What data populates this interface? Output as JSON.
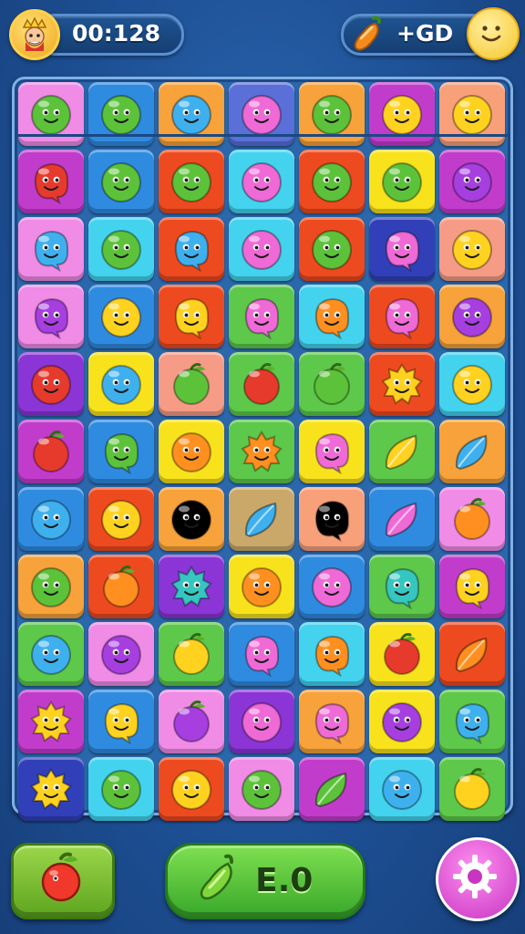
{
  "hud": {
    "timer": "00:128",
    "bonus": "+GD"
  },
  "footer": {
    "score_label": "E.0"
  },
  "colors": {
    "pink": "#f08be6",
    "blue": "#2f8be0",
    "orange": "#f7a23a",
    "indigo": "#5a6fd8",
    "magenta": "#c23ccc",
    "peach": "#f7a07a",
    "red": "#ee4a1f",
    "cyan": "#43d3ee",
    "yellow": "#f8e21c",
    "purple": "#8b35d6",
    "green": "#5dc84a",
    "salmon": "#f59b86",
    "tan": "#c9a86a",
    "navy": "#3140b8",
    "face_green": "#5cc23a",
    "face_blue": "#3fb0ee",
    "face_pink": "#ef6ad6",
    "face_yellow": "#ffd21f",
    "face_red": "#e63a2c",
    "face_orange": "#ff8f1f",
    "face_purple": "#a63ee0",
    "face_teal": "#36c6c0"
  },
  "board": {
    "rows": [
      [
        [
          "pink",
          "face_green",
          "face"
        ],
        [
          "blue",
          "face_green",
          "face"
        ],
        [
          "orange",
          "face_blue",
          "face"
        ],
        [
          "indigo",
          "face_pink",
          "face"
        ],
        [
          "orange",
          "face_green",
          "face"
        ],
        [
          "magenta",
          "face_yellow",
          "face"
        ],
        [
          "peach",
          "face_yellow",
          "face"
        ]
      ],
      [
        [
          "magenta",
          "face_red",
          "blob"
        ],
        [
          "blue",
          "face_green",
          "face"
        ],
        [
          "red",
          "face_green",
          "face"
        ],
        [
          "cyan",
          "face_pink",
          "face"
        ],
        [
          "red",
          "face_green",
          "face"
        ],
        [
          "yellow",
          "face_green",
          "face"
        ],
        [
          "magenta",
          "face_purple",
          "face"
        ]
      ],
      [
        [
          "pink",
          "face_blue",
          "blob"
        ],
        [
          "cyan",
          "face_green",
          "face"
        ],
        [
          "red",
          "face_blue",
          "blob"
        ],
        [
          "cyan",
          "face_pink",
          "face"
        ],
        [
          "red",
          "face_green",
          "face"
        ],
        [
          "navy",
          "face_pink",
          "blob"
        ],
        [
          "salmon",
          "face_yellow",
          "face"
        ]
      ],
      [
        [
          "pink",
          "face_purple",
          "blob"
        ],
        [
          "blue",
          "face_yellow",
          "face"
        ],
        [
          "red",
          "face_yellow",
          "blob"
        ],
        [
          "green",
          "face_pink",
          "blob"
        ],
        [
          "cyan",
          "face_orange",
          "blob"
        ],
        [
          "red",
          "face_pink",
          "blob"
        ],
        [
          "orange",
          "face_purple",
          "face"
        ]
      ],
      [
        [
          "purple",
          "face_red",
          "face"
        ],
        [
          "yellow",
          "face_blue",
          "face"
        ],
        [
          "salmon",
          "face_green",
          "fruit"
        ],
        [
          "green",
          "face_red",
          "fruit"
        ],
        [
          "green",
          "face_green",
          "fruit"
        ],
        [
          "red",
          "face_yellow",
          "star"
        ],
        [
          "cyan",
          "face_yellow",
          "face"
        ]
      ],
      [
        [
          "magenta",
          "face_red",
          "fruit"
        ],
        [
          "blue",
          "face_green",
          "blob"
        ],
        [
          "yellow",
          "face_orange",
          "face"
        ],
        [
          "green",
          "face_orange",
          "star"
        ],
        [
          "yellow",
          "face_pink",
          "blob"
        ],
        [
          "green",
          "face_yellow",
          "leaf"
        ],
        [
          "orange",
          "face_blue",
          "leaf"
        ]
      ],
      [
        [
          "blue",
          "face_blue",
          "face"
        ],
        [
          "red",
          "face_yellow",
          "face"
        ],
        [
          "orange",
          "face_indigo",
          "face"
        ],
        [
          "tan",
          "face_blue",
          "leaf"
        ],
        [
          "peach",
          "face_indigo",
          "blob"
        ],
        [
          "blue",
          "face_pink",
          "leaf"
        ],
        [
          "pink",
          "face_orange",
          "fruit"
        ]
      ],
      [
        [
          "orange",
          "face_green",
          "face"
        ],
        [
          "red",
          "face_orange",
          "fruit"
        ],
        [
          "purple",
          "face_teal",
          "star"
        ],
        [
          "yellow",
          "face_orange",
          "face"
        ],
        [
          "blue",
          "face_pink",
          "face"
        ],
        [
          "green",
          "face_teal",
          "blob"
        ],
        [
          "magenta",
          "face_yellow",
          "blob"
        ]
      ],
      [
        [
          "green",
          "face_blue",
          "face"
        ],
        [
          "pink",
          "face_purple",
          "face"
        ],
        [
          "green",
          "face_yellow",
          "fruit"
        ],
        [
          "blue",
          "face_pink",
          "blob"
        ],
        [
          "cyan",
          "face_orange",
          "blob"
        ],
        [
          "yellow",
          "face_red",
          "fruit"
        ],
        [
          "red",
          "face_orange",
          "leaf"
        ]
      ],
      [
        [
          "magenta",
          "face_yellow",
          "star"
        ],
        [
          "blue",
          "face_yellow",
          "blob"
        ],
        [
          "pink",
          "face_purple",
          "fruit"
        ],
        [
          "purple",
          "face_pink",
          "face"
        ],
        [
          "orange",
          "face_pink",
          "blob"
        ],
        [
          "yellow",
          "face_purple",
          "face"
        ],
        [
          "green",
          "face_blue",
          "blob"
        ]
      ],
      [
        [
          "navy",
          "face_yellow",
          "star"
        ],
        [
          "cyan",
          "face_green",
          "face"
        ],
        [
          "red",
          "face_yellow",
          "face"
        ],
        [
          "pink",
          "face_green",
          "face"
        ],
        [
          "magenta",
          "face_green",
          "leaf"
        ],
        [
          "cyan",
          "face_blue",
          "face"
        ],
        [
          "green",
          "face_yellow",
          "fruit"
        ]
      ]
    ]
  },
  "icons": {
    "avatar": "king-avatar-icon",
    "bonus": "pepper-icon",
    "coin": "smiley-coin-icon",
    "boost_left": "red-fruit-booster-icon",
    "boost_mid": "green-pepper-icon",
    "settings": "gear-icon"
  }
}
